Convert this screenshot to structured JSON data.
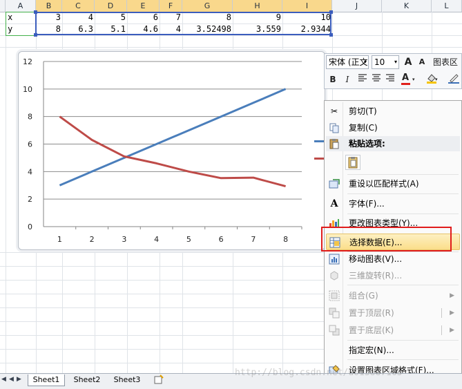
{
  "columns": [
    "A",
    "B",
    "C",
    "D",
    "E",
    "F",
    "G",
    "H",
    "I",
    "J",
    "K",
    "L"
  ],
  "rows": [
    {
      "label": "x",
      "values": [
        "3",
        "4",
        "5",
        "6",
        "7",
        "8",
        "9",
        "10"
      ]
    },
    {
      "label": "y",
      "values": [
        "8",
        "6.3",
        "5.1",
        "4.6",
        "4",
        "3.52498",
        "3.559",
        "2.9344"
      ]
    }
  ],
  "chart_data": {
    "type": "line",
    "x": [
      1,
      2,
      3,
      4,
      5,
      6,
      7,
      8
    ],
    "series": [
      {
        "values": [
          3,
          4,
          5,
          6,
          7,
          8,
          9,
          10
        ],
        "color": "#4a7ebb"
      },
      {
        "values": [
          8,
          6.3,
          5.1,
          4.6,
          4,
          3.52498,
          3.559,
          2.9344
        ],
        "color": "#be4b48"
      }
    ],
    "categories": [
      "1",
      "2",
      "3",
      "4",
      "5",
      "6",
      "7",
      "8"
    ],
    "yticks": [
      "0",
      "2",
      "4",
      "6",
      "8",
      "10",
      "12"
    ],
    "ylim": [
      0,
      12
    ],
    "grid": true,
    "legend": "right"
  },
  "toolbar": {
    "font_name": "宋体 (正文",
    "font_size": "10",
    "grow_font": "A",
    "shrink_font": "A",
    "chart_area_label": "图表区",
    "bold": "B",
    "italic": "I"
  },
  "menu": {
    "items": [
      {
        "label": "剪切(T)",
        "icon": "scissors-icon",
        "enabled": true
      },
      {
        "label": "复制(C)",
        "icon": "copy-icon",
        "enabled": true
      },
      {
        "label": "粘贴选项:",
        "icon": "paste-icon",
        "enabled": true
      },
      {
        "label": "重设以匹配样式(A)",
        "icon": "reset-style-icon",
        "enabled": true
      },
      {
        "label": "字体(F)...",
        "icon": "font-icon",
        "enabled": true
      },
      {
        "label": "更改图表类型(Y)...",
        "icon": "chart-type-icon",
        "enabled": true
      },
      {
        "label": "选择数据(E)...",
        "icon": "select-data-icon",
        "enabled": true
      },
      {
        "label": "移动图表(V)...",
        "icon": "move-chart-icon",
        "enabled": true
      },
      {
        "label": "三维旋转(R)...",
        "icon": "3d-rotation-icon",
        "enabled": false
      },
      {
        "label": "组合(G)",
        "icon": "group-icon",
        "enabled": false
      },
      {
        "label": "置于顶层(R)",
        "icon": "bring-to-front-icon",
        "enabled": false
      },
      {
        "label": "置于底层(K)",
        "icon": "send-to-back-icon",
        "enabled": false
      },
      {
        "label": "指定宏(N)...",
        "icon": "",
        "enabled": true
      },
      {
        "label": "设置图表区域格式(F)...",
        "icon": "format-chart-area-icon",
        "enabled": true
      }
    ]
  },
  "sheets": [
    "Sheet1",
    "Sheet2",
    "Sheet3"
  ],
  "watermark": "http://blog.csdn.net/u013887165"
}
